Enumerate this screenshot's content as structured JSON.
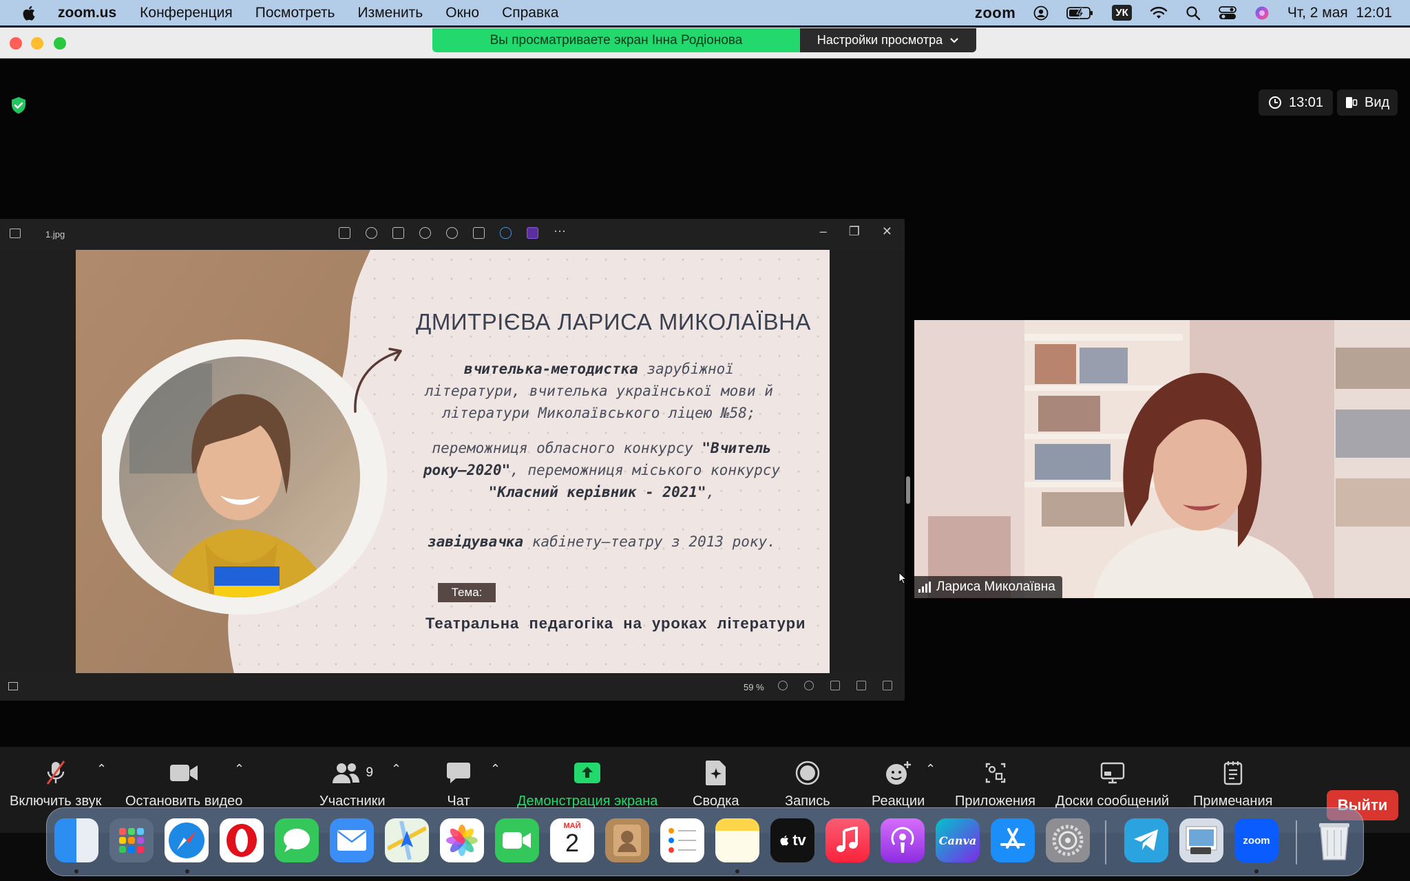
{
  "menubar": {
    "app_name": "zoom.us",
    "menus": [
      "Конференция",
      "Посмотреть",
      "Изменить",
      "Окно",
      "Справка"
    ],
    "zoom_label": "zoom",
    "keyboard_layout": "УК",
    "datetime": "Чт, 2 мая  12:01"
  },
  "share_banner": {
    "message": "Вы просматриваете экран Інна Родіонова",
    "settings_label": "Настройки просмотра"
  },
  "meeting": {
    "timer": "13:01",
    "view_label": "Вид"
  },
  "viewer": {
    "filename": "1.jpg",
    "zoom_percent": "59 %"
  },
  "slide": {
    "name": "ДМИТРІЄВА ЛАРИСА МИКОЛАЇВНА",
    "para1_bold": "вчителька-методистка",
    "para1_rest": " зарубіжної літератури, вчителька української мови й літератури Миколаївського ліцею №58;",
    "para2_a": "переможниця обласного конкурсу ",
    "para2_b": "\"Вчитель року–2020\"",
    "para2_c": ", переможниця міського конкурсу ",
    "para2_d": "\"Класний керівник - 2021\"",
    "para2_e": ",",
    "para3_bold": "завідувачка",
    "para3_rest": " кабінету–театру з 2013 року.",
    "tema_label": "Тема:",
    "topic": "Театральна  педагогіка  на  уроках  літератури"
  },
  "participant": {
    "name": "Лариса Миколаївна"
  },
  "toolbar": {
    "unmute": "Включить звук",
    "stop_video": "Остановить видео",
    "participants": "Участники",
    "participants_count": "9",
    "chat": "Чат",
    "share_screen": "Демонстрация экрана",
    "summary": "Сводка",
    "record": "Запись",
    "reactions": "Реакции",
    "apps": "Приложения",
    "whiteboards": "Доски сообщений",
    "notes": "Примечания",
    "leave": "Выйти"
  },
  "dock": {
    "calendar_month": "МАЙ",
    "calendar_day": "2",
    "tv_label": "tv",
    "canva_label": "Canva",
    "zoom_label": "zoom"
  },
  "colors": {
    "share_green": "#23d96e",
    "leave_red": "#d9362f",
    "menubar_bg": "#b3cde8"
  }
}
